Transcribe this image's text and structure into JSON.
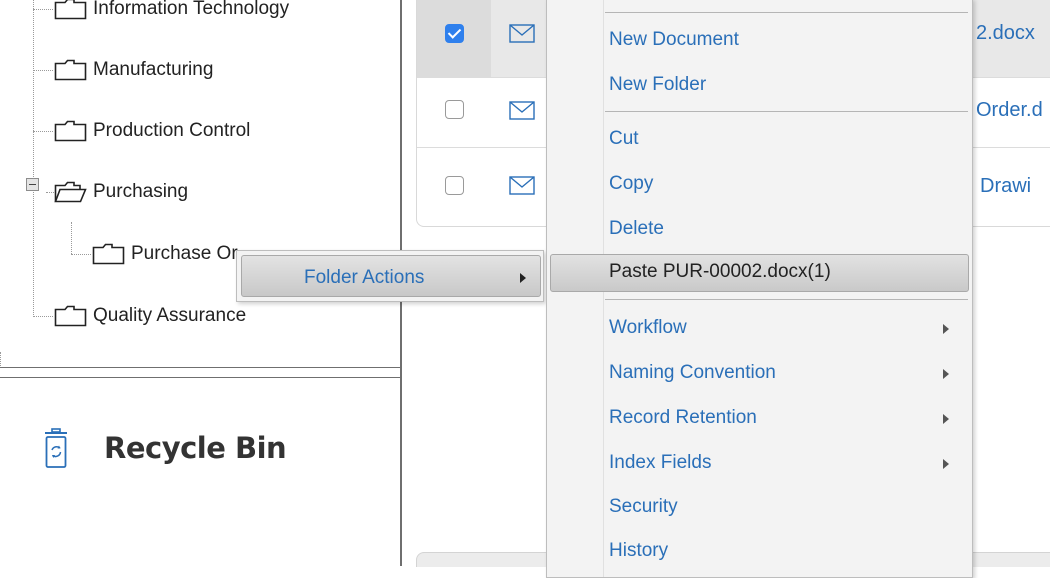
{
  "tree": {
    "nodes": [
      {
        "label": "Information Technology"
      },
      {
        "label": "Manufacturing"
      },
      {
        "label": "Production Control"
      },
      {
        "label": "Purchasing"
      },
      {
        "label": "Purchase Or"
      },
      {
        "label": "Quality Assurance"
      }
    ]
  },
  "recycle_bin": {
    "label": "Recycle Bin",
    "icon": "recycle-bin-icon"
  },
  "documents": {
    "rows": [
      {
        "checked": true,
        "name": "2.docx"
      },
      {
        "checked": false,
        "name": "Order.d"
      },
      {
        "checked": false,
        "name": "Drawi"
      }
    ]
  },
  "submenu": {
    "folder_actions": "Folder Actions"
  },
  "context_menu": {
    "items": {
      "new_document": "New Document",
      "new_folder": "New Folder",
      "cut": "Cut",
      "copy": "Copy",
      "delete": "Delete",
      "paste": "Paste PUR-00002.docx(1)",
      "workflow": "Workflow",
      "naming_convention": "Naming Convention",
      "record_retention": "Record Retention",
      "index_fields": "Index Fields",
      "security": "Security",
      "history": "History"
    }
  },
  "colors": {
    "link": "#2a6fb8",
    "checkbox_checked": "#2f80ed",
    "selected_row": "#e8e8e8"
  }
}
